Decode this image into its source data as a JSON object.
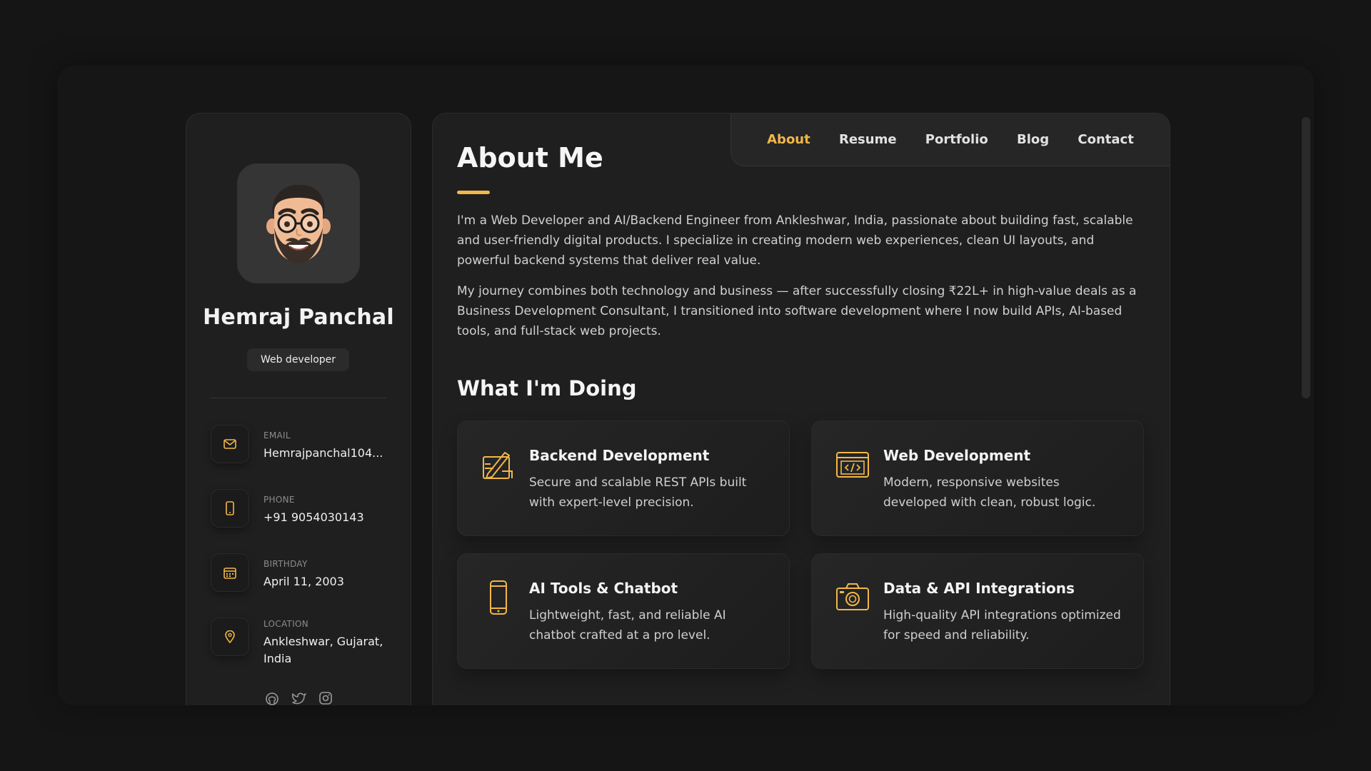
{
  "colors": {
    "accent": "#f2b749",
    "background": "#151515",
    "panel": "#1f1f1f"
  },
  "profile": {
    "name": "Hemraj Panchal",
    "title": "Web developer",
    "avatar_icon": "memoji-avatar"
  },
  "contacts": [
    {
      "icon": "mail-icon",
      "label": "Email",
      "value": "Hemrajpanchal104..."
    },
    {
      "icon": "phone-icon",
      "label": "Phone",
      "value": "+91 9054030143"
    },
    {
      "icon": "calendar-icon",
      "label": "Birthday",
      "value": "April 11, 2003"
    },
    {
      "icon": "location-pin-icon",
      "label": "Location",
      "value": "Ankleshwar, Gujarat, India"
    }
  ],
  "socials": [
    "github-icon",
    "twitter-icon",
    "instagram-icon"
  ],
  "nav": {
    "items": [
      "About",
      "Resume",
      "Portfolio",
      "Blog",
      "Contact"
    ],
    "active": "About"
  },
  "about": {
    "title": "About Me",
    "paragraphs": [
      "I'm a Web Developer and AI/Backend Engineer from Ankleshwar, India, passionate about building fast, scalable and user-friendly digital products. I specialize in creating modern web experiences, clean UI layouts, and powerful backend systems that deliver real value.",
      "My journey combines both technology and business — after successfully closing ₹22L+ in high-value deals as a Business Development Consultant, I transitioned into software development where I now build APIs, AI-based tools, and full-stack web projects."
    ]
  },
  "doing": {
    "title": "What I'm Doing",
    "services": [
      {
        "icon": "design-pencil-icon",
        "title": "Backend Development",
        "desc": "Secure and scalable REST APIs built with expert-level precision."
      },
      {
        "icon": "code-window-icon",
        "title": "Web Development",
        "desc": "Modern, responsive websites developed with clean, robust logic."
      },
      {
        "icon": "mobile-phone-icon",
        "title": "AI Tools & Chatbot",
        "desc": "Lightweight, fast, and reliable AI chatbot crafted at a pro level."
      },
      {
        "icon": "camera-icon",
        "title": "Data & API Integrations",
        "desc": "High-quality API integrations optimized for speed and reliability."
      }
    ]
  }
}
